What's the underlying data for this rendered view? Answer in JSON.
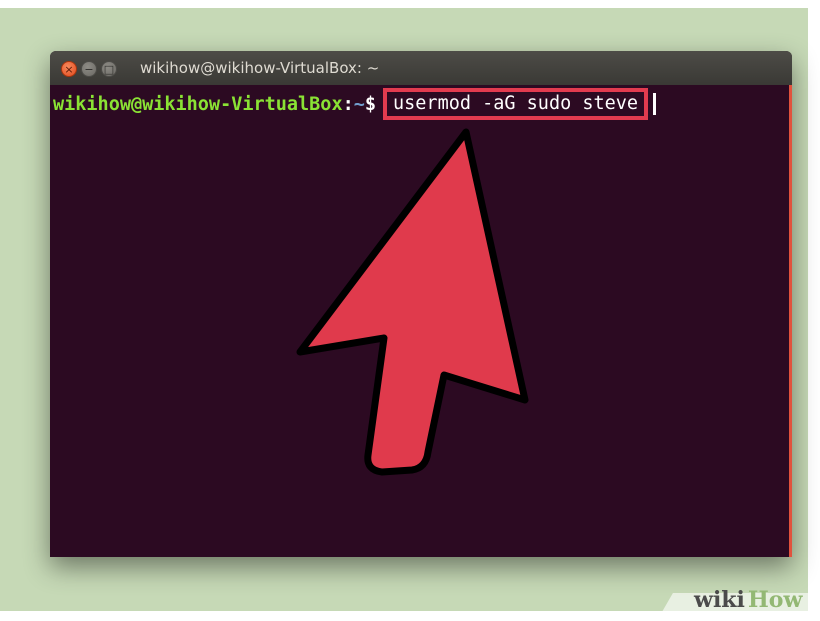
{
  "window": {
    "title": "wikihow@wikihow-VirtualBox: ~",
    "buttons": {
      "close_glyph": "×",
      "minimize_glyph": "−",
      "maximize_glyph": "□"
    }
  },
  "terminal": {
    "prompt_user_host": "wikihow@wikihow-VirtualBox",
    "prompt_colon": ":",
    "prompt_path": "~",
    "prompt_symbol": "$",
    "command": "usermod -aG sudo steve"
  },
  "annotation": {
    "arrow_icon": "red-pointer-arrow-icon",
    "highlight_color": "#e23b4f",
    "arrow_color": "#e03a4c"
  },
  "watermark": {
    "wiki": "wiki",
    "how": "How"
  },
  "colors": {
    "terminal_bg": "#2c0a22",
    "prompt_green": "#8ae234",
    "prompt_blue": "#729fcf",
    "backdrop": "#c6d9b6"
  }
}
